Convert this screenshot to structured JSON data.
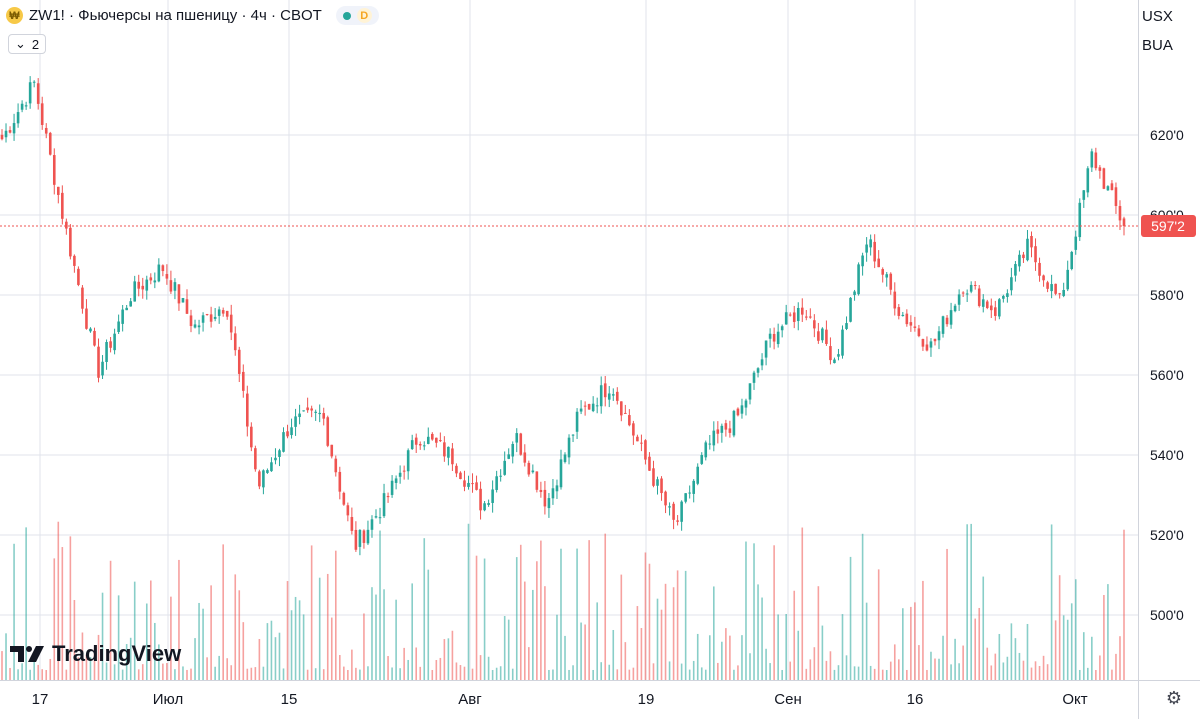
{
  "header": {
    "icon": "wheat-coin-icon",
    "title": "ZW1! · Фьючерсы на пшеницу · 4ч · CBOT",
    "status_dot_color": "#26a69a",
    "badge": "D",
    "collapse_count": "2"
  },
  "currency": {
    "label": "USX",
    "sub": "BUA"
  },
  "brand": "TradingView",
  "colors": {
    "up": "#26a69a",
    "down": "#ef5350"
  },
  "chart_data": {
    "type": "candlestick",
    "title": "ZW1! · Фьючерсы на пшеницу · 4ч · CBOT",
    "xlabel": "",
    "ylabel": "",
    "ylim": [
      484,
      640
    ],
    "y_ticks": [
      500,
      520,
      540,
      560,
      580,
      600,
      620
    ],
    "y_tick_labels": [
      "500'0",
      "520'0",
      "540'0",
      "560'0",
      "580'0",
      "600'0",
      "620'0"
    ],
    "x_tick_labels": [
      "17",
      "Июл",
      "15",
      "Авг",
      "19",
      "Сен",
      "16",
      "Окт"
    ],
    "last_price": 597.25,
    "last_price_label": "597'2",
    "grid": true,
    "key_closes": [
      {
        "date": "Jun 17",
        "value": 619
      },
      {
        "date": "Jun 18",
        "value": 633
      },
      {
        "date": "Jun 24",
        "value": 596
      },
      {
        "date": "Jun 28",
        "value": 561
      },
      {
        "date": "Jul 03",
        "value": 580
      },
      {
        "date": "Jul 08",
        "value": 587
      },
      {
        "date": "Jul 12",
        "value": 572
      },
      {
        "date": "Jul 15",
        "value": 578
      },
      {
        "date": "Jul 17",
        "value": 532
      },
      {
        "date": "Jul 22",
        "value": 548
      },
      {
        "date": "Jul 26",
        "value": 550
      },
      {
        "date": "Jul 30",
        "value": 517
      },
      {
        "date": "Aug 02",
        "value": 529
      },
      {
        "date": "Aug 07",
        "value": 545
      },
      {
        "date": "Aug 12",
        "value": 540
      },
      {
        "date": "Aug 15",
        "value": 527
      },
      {
        "date": "Aug 16",
        "value": 545
      },
      {
        "date": "Aug 19",
        "value": 528
      },
      {
        "date": "Aug 19b",
        "value": 550
      },
      {
        "date": "Aug 23",
        "value": 558
      },
      {
        "date": "Aug 26",
        "value": 540
      },
      {
        "date": "Aug 29",
        "value": 522
      },
      {
        "date": "Sep 02",
        "value": 542
      },
      {
        "date": "Sep 05",
        "value": 550
      },
      {
        "date": "Sep 07",
        "value": 570
      },
      {
        "date": "Sep 09",
        "value": 577
      },
      {
        "date": "Sep 11",
        "value": 564
      },
      {
        "date": "Sep 16",
        "value": 594
      },
      {
        "date": "Sep 18",
        "value": 576
      },
      {
        "date": "Sep 20",
        "value": 567
      },
      {
        "date": "Sep 24",
        "value": 583
      },
      {
        "date": "Sep 26",
        "value": 576
      },
      {
        "date": "Sep 30",
        "value": 592
      },
      {
        "date": "Oct 02",
        "value": 578
      },
      {
        "date": "Oct 04",
        "value": 615
      },
      {
        "date": "Oct 07",
        "value": 597.25
      }
    ]
  }
}
